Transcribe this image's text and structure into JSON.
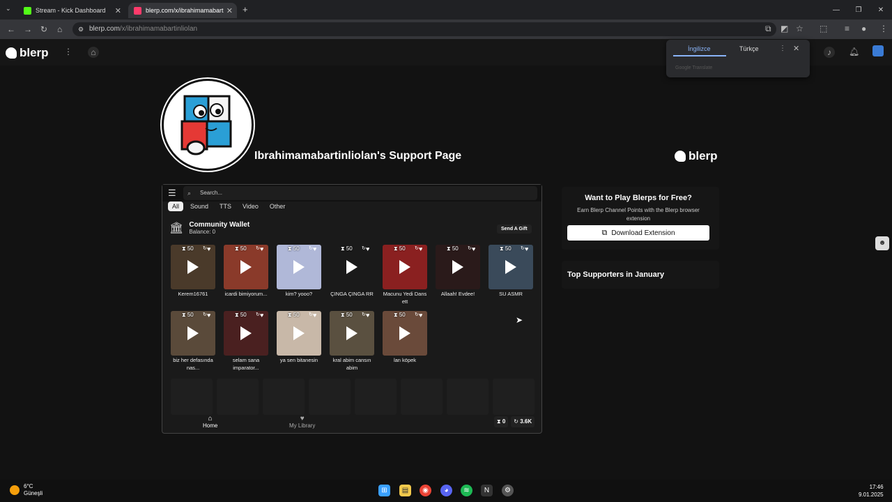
{
  "browser": {
    "tabs": [
      {
        "title": "Stream - Kick Dashboard",
        "favicon_color": "#53fc18"
      },
      {
        "title": "blerp.com/x/ibrahimamabartinl",
        "favicon_color": "#ff3b6b"
      }
    ],
    "url_host": "blerp.com",
    "url_path": "/x/ibrahimamabartinliolan"
  },
  "site": {
    "logo_text": "blerp",
    "brand_logo_text": "blerp"
  },
  "translate_popup": {
    "lang_source": "İngilizce",
    "lang_target": "Türkçe",
    "footer": "Google Translate"
  },
  "profile": {
    "page_title": "Ibrahimamabartinliolan's Support Page"
  },
  "panel": {
    "search_placeholder": "Search...",
    "filters": [
      "All",
      "Sound",
      "TTS",
      "Video",
      "Other"
    ],
    "wallet_title": "Community Wallet",
    "wallet_balance": "Balance: 0",
    "gift_button": "Send A Gift",
    "cards": [
      {
        "price": "50",
        "label": "Kerem16761",
        "color": "#4a3a2a"
      },
      {
        "price": "50",
        "label": "icardi bimiyorum...",
        "color": "#8a3a2a"
      },
      {
        "price": "50",
        "label": "kim? yooo?",
        "color": "#b0b8d8"
      },
      {
        "price": "50",
        "label": "ÇINGA ÇINGA RR",
        "color": "#1a1a1a"
      },
      {
        "price": "50",
        "label": "Macunu Yedi Dans ett",
        "color": "#8a2020"
      },
      {
        "price": "50",
        "label": "Allaah! Evdee!",
        "color": "#2a1a1a"
      },
      {
        "price": "50",
        "label": "SU ASMR",
        "color": "#3a4a5a"
      },
      {
        "price": "50",
        "label": "biz her defasında nas...",
        "color": "#5a4a3a"
      },
      {
        "price": "50",
        "label": "selam sana imparator...",
        "color": "#4a2020"
      },
      {
        "price": "50",
        "label": "ya sen bitanesin",
        "color": "#c8b8a8"
      },
      {
        "price": "50",
        "label": "kral abim cansın abim",
        "color": "#5a5040"
      },
      {
        "price": "50",
        "label": "lan köpek",
        "color": "#6a4a3a"
      }
    ],
    "nav_home": "Home",
    "nav_library": "My Library",
    "points_count": "0",
    "rerun_count": "3.6K"
  },
  "sidebar": {
    "promo_title": "Want to Play Blerps for Free?",
    "promo_desc": "Earn Blerp Channel Points with the Blerp browser extension",
    "download_button": "Download Extension",
    "top_supporters": "Top Supporters in January"
  },
  "taskbar": {
    "temp": "6°C",
    "weather": "Güneşli",
    "time": "17:46",
    "date": "9.01.2025"
  }
}
